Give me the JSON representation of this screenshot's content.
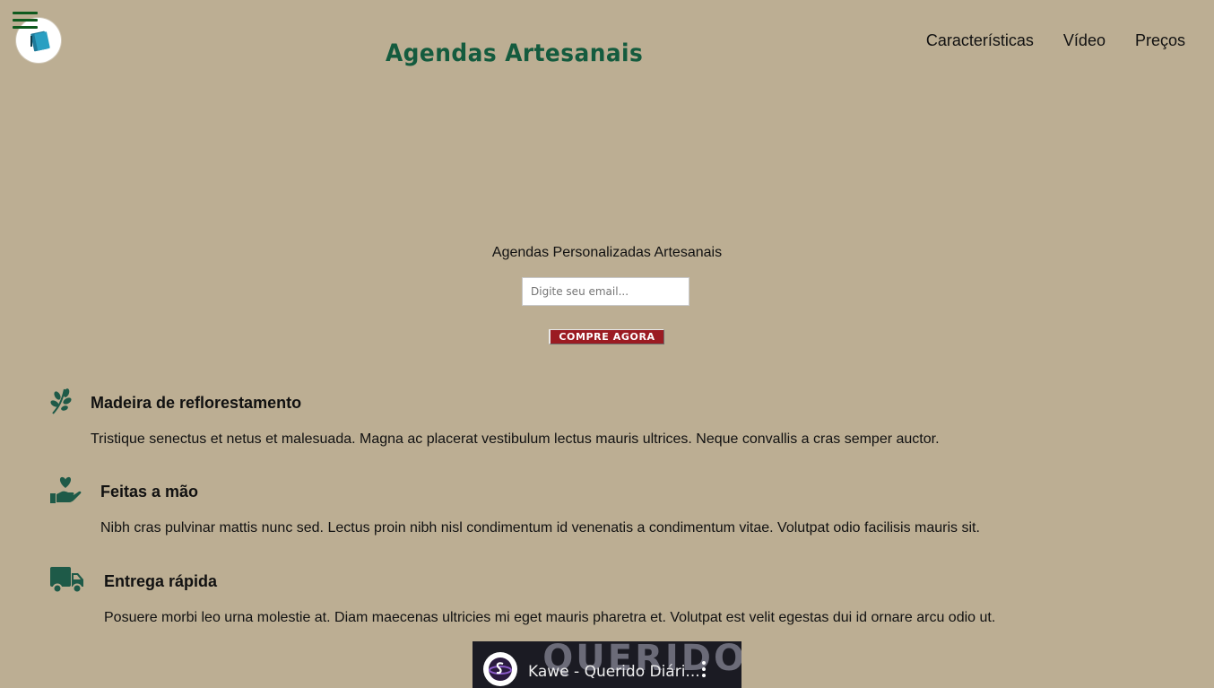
{
  "header": {
    "brand": "Agendas Artesanais",
    "nav": [
      "Características",
      "Vídeo",
      "Preços"
    ]
  },
  "hero": {
    "subtitle": "Agendas Personalizadas Artesanais",
    "email_placeholder": "Digite seu email...",
    "cta_label": "COMPRE AGORA"
  },
  "features": [
    {
      "icon": "leaf-icon",
      "title": "Madeira de reflorestamento",
      "text": "Tristique senectus et netus et malesuada. Magna ac placerat vestibulum lectus mauris ultrices. Neque convallis a cras semper auctor."
    },
    {
      "icon": "hand-heart-icon",
      "title": "Feitas a mão",
      "text": "Nibh cras pulvinar mattis nunc sed. Lectus proin nibh nisl condimentum id venenatis a condimentum vitae. Volutpat odio facilisis mauris sit."
    },
    {
      "icon": "truck-icon",
      "title": "Entrega rápida",
      "text": "Posuere morbi leo urna molestie at. Diam maecenas ultricies mi eget mauris pharetra et. Volutpat est velit egestas dui id ornare arcu odio ut."
    }
  ],
  "video": {
    "title": "Kawe - Querido Diári...",
    "background_text": "QUERIDO"
  },
  "colors": {
    "background": "#bcae93",
    "brand": "#145b3e",
    "icon": "#1e5a48",
    "cta": "#9b1b22"
  }
}
